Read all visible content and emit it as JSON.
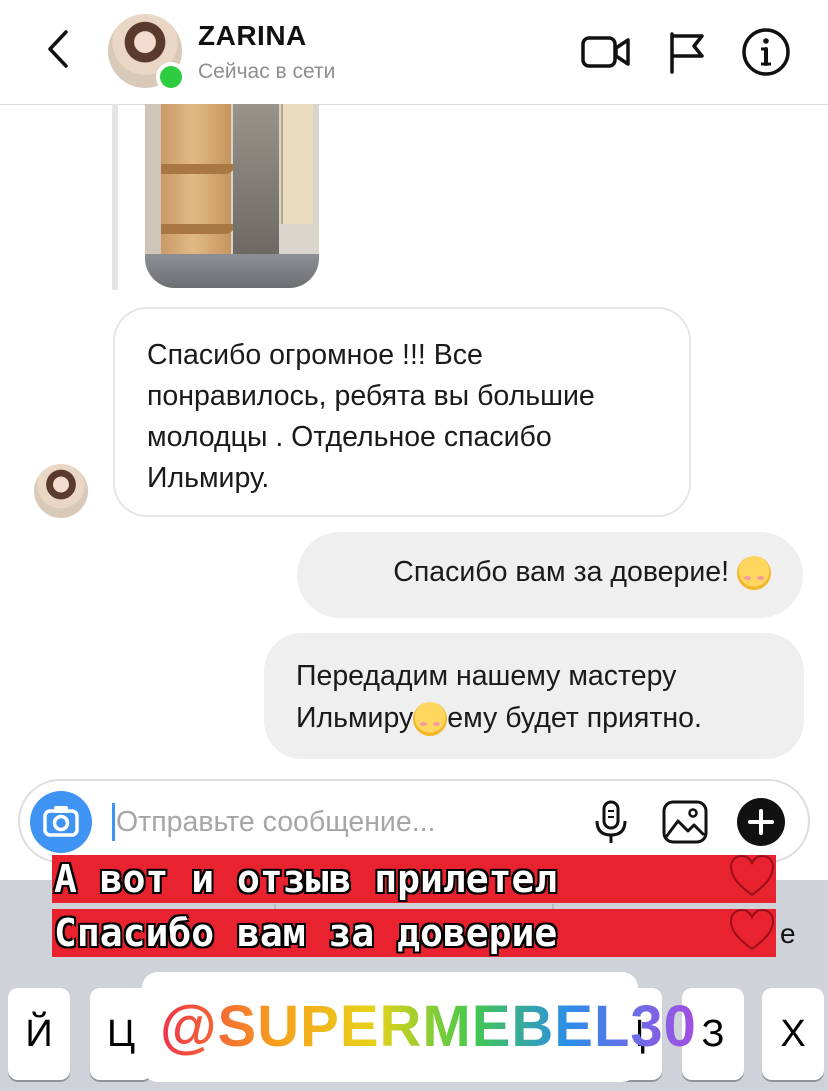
{
  "header": {
    "name": "ZARINA",
    "status": "Сейчас в сети"
  },
  "messages": {
    "incoming": "Спасибо огромное !!! Все понравилось, ребята вы большие молодцы . Отдельное спасибо Ильмиру.",
    "outgoing_1": "Спасибо вам за доверие!",
    "outgoing_2_part1": "Передадим нашему мастеру Ильмиру",
    "outgoing_2_part2": "ему будет приятно."
  },
  "composer": {
    "placeholder": "Отправьте сообщение..."
  },
  "keyboard": {
    "suggestion_partial": "е",
    "keys": [
      "Й",
      "Ц",
      "Ц",
      "З",
      "Х"
    ]
  },
  "overlay": {
    "line1": "А вот и отзыв прилетел",
    "line2": "Спасибо вам за доверие",
    "tag": "@SUPERMEBEL30"
  },
  "colors": {
    "online": "#2ecc40",
    "accent_blue": "#3f93f2",
    "banner_red": "#e8232f"
  }
}
